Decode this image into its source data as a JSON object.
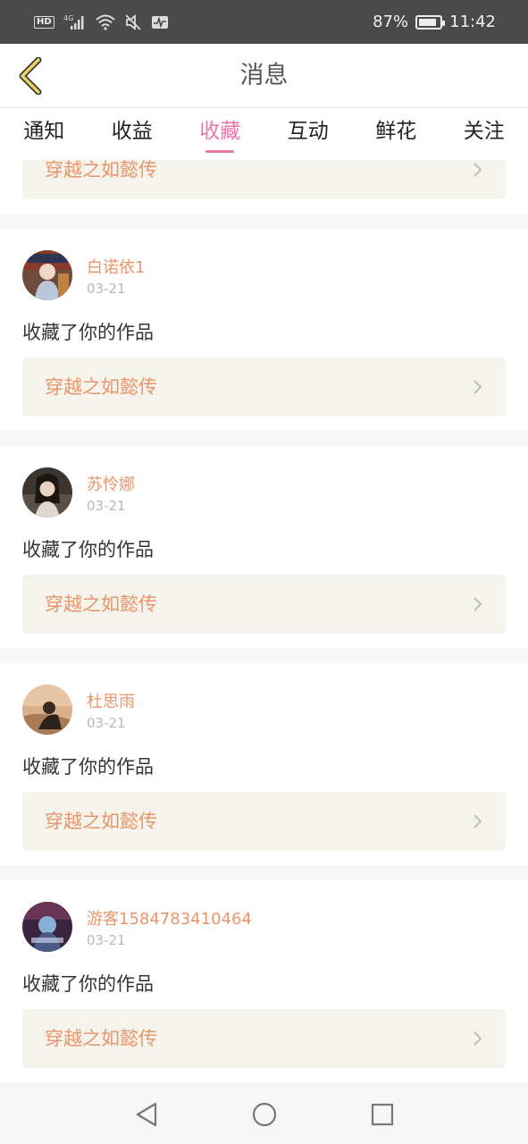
{
  "status_bar": {
    "hd_label": "HD",
    "network_label": "4G",
    "battery_percent_text": "87%",
    "battery_level": 0.87,
    "time": "11:42",
    "icons": [
      "hd-icon",
      "signal-icon",
      "wifi-icon",
      "mute-icon",
      "activity-icon",
      "battery-icon"
    ]
  },
  "header": {
    "title": "消息",
    "back_icon": "chevron-left-icon"
  },
  "tabs": [
    {
      "label": "通知",
      "active": false
    },
    {
      "label": "收益",
      "active": false
    },
    {
      "label": "收藏",
      "active": true
    },
    {
      "label": "互动",
      "active": false
    },
    {
      "label": "鲜花",
      "active": false
    },
    {
      "label": "关注",
      "active": false
    }
  ],
  "feed": {
    "partial_work_title": "穿越之如懿传",
    "items": [
      {
        "user": "白诺依1",
        "date": "03-21",
        "action": "收藏了你的作品",
        "work": "穿越之如懿传"
      },
      {
        "user": "苏怜娜",
        "date": "03-21",
        "action": "收藏了你的作品",
        "work": "穿越之如懿传"
      },
      {
        "user": "杜思雨",
        "date": "03-21",
        "action": "收藏了你的作品",
        "work": "穿越之如懿传"
      },
      {
        "user": "游客1584783410464",
        "date": "03-21",
        "action": "收藏了你的作品",
        "work": "穿越之如懿传"
      }
    ]
  },
  "colors": {
    "accent_pink": "#e878a8",
    "name_orange": "#e9956b",
    "link_bg": "#f5f4ec",
    "status_bar_bg": "#4a4a4a"
  },
  "nav_bar": {
    "icons": [
      "back-triangle-icon",
      "home-circle-icon",
      "recents-square-icon"
    ]
  }
}
